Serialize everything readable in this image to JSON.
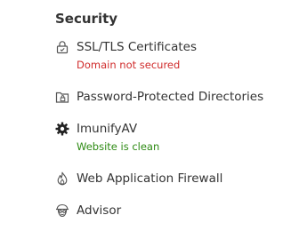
{
  "section": {
    "title": "Security"
  },
  "items": [
    {
      "label": "SSL/TLS Certificates",
      "icon": "lock-icon",
      "status": "Domain not secured",
      "status_color": "#d02c2c"
    },
    {
      "label": "Password-Protected Directories",
      "icon": "locked-folder-icon"
    },
    {
      "label": "ImunifyAV",
      "icon": "gear-icon",
      "status": "Website is clean",
      "status_color": "#2d8a13"
    },
    {
      "label": "Web Application Firewall",
      "icon": "flame-icon"
    },
    {
      "label": "Advisor",
      "icon": "advisor-icon"
    }
  ]
}
